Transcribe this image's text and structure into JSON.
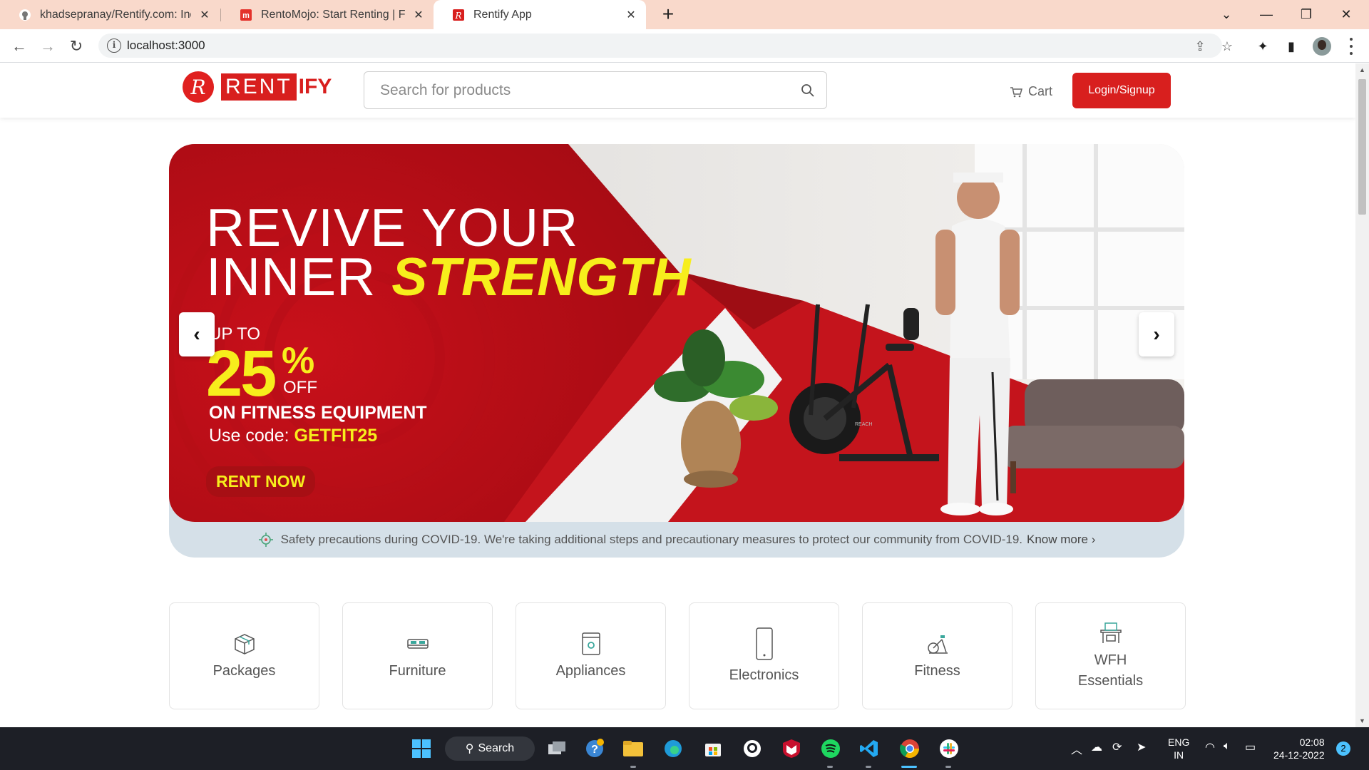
{
  "browser": {
    "tabs": [
      {
        "title": "khadsepranay/Rentify.com: India",
        "active": false
      },
      {
        "title": "RentoMojo: Start Renting | Furnit",
        "active": false
      },
      {
        "title": "Rentify App",
        "active": true
      }
    ],
    "new_tab_label": "+",
    "url": "localhost:3000"
  },
  "site": {
    "logo_mark": "R",
    "logo_rent": "RENT",
    "logo_ify": "IFY",
    "search_placeholder": "Search for products",
    "cart_label": "Cart",
    "login_label": "Login/Signup"
  },
  "banner": {
    "line1": "REVIVE YOUR",
    "line2_plain": "INNER ",
    "line2_highlight": "STRENGTH",
    "up_to": "UP TO",
    "percent": "25",
    "percent_sign": "%",
    "off": "OFF",
    "category": "ON FITNESS EQUIPMENT",
    "code_prefix": "Use code: ",
    "code": "GETFIT25",
    "cta": "RENT NOW",
    "bike_brand": "REACH",
    "colors": {
      "red": "#d81f1e",
      "yellow": "#f7ee1c"
    }
  },
  "covid_notice": {
    "text": "Safety precautions during COVID-19. We're taking additional steps and precautionary measures to protect our community from COVID-19.",
    "link": "Know more"
  },
  "categories": [
    {
      "label": "Packages",
      "icon": "package-icon"
    },
    {
      "label": "Furniture",
      "icon": "bed-icon"
    },
    {
      "label": "Appliances",
      "icon": "washing-machine-icon"
    },
    {
      "label": "Electronics",
      "icon": "smartphone-icon"
    },
    {
      "label": "Fitness",
      "icon": "exercise-bike-icon"
    },
    {
      "label": "WFH Essentials",
      "icon": "desk-chair-icon"
    }
  ],
  "taskbar": {
    "search_label": "Search",
    "lang_line1": "ENG",
    "lang_line2": "IN",
    "time": "02:08",
    "date": "24-12-2022",
    "notifications": "2"
  }
}
